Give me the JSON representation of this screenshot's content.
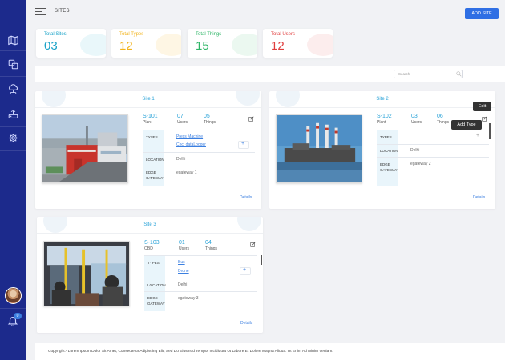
{
  "header": {
    "title": "SITES",
    "add_site_label": "ADD SITE"
  },
  "stats": [
    {
      "label": "Total Sites",
      "value": "03",
      "color": "#1aa3c8"
    },
    {
      "label": "Total Types",
      "value": "12",
      "color": "#f2b31b"
    },
    {
      "label": "Total Things",
      "value": "15",
      "color": "#2db566"
    },
    {
      "label": "Total Users",
      "value": "12",
      "color": "#e03d3d"
    }
  ],
  "search": {
    "placeholder": "Search"
  },
  "sites": [
    {
      "title": "Site 1",
      "metrics": [
        {
          "value": "S-101",
          "label": "Plant"
        },
        {
          "value": "07",
          "label": "Users"
        },
        {
          "value": "05",
          "label": "Things"
        }
      ],
      "labels": {
        "types": "TYPES",
        "location": "LOCATION",
        "gateway": "EDGE GATEWAY"
      },
      "types": [
        "Press Machine",
        "Cnc_dataLogger"
      ],
      "location": "Delhi",
      "gateway": "egateway 1",
      "details": "Details"
    },
    {
      "title": "Site 2",
      "metrics": [
        {
          "value": "S-102",
          "label": "Plant"
        },
        {
          "value": "03",
          "label": "Users"
        },
        {
          "value": "06",
          "label": "Things"
        }
      ],
      "labels": {
        "types": "TYPES",
        "location": "LOCATION",
        "gateway": "EDGE GATEWAY"
      },
      "types": [],
      "location": "Delhi",
      "gateway": "egateway 2",
      "details": "Details"
    },
    {
      "title": "Site 3",
      "metrics": [
        {
          "value": "S-103",
          "label": "OBD"
        },
        {
          "value": "01",
          "label": "Users"
        },
        {
          "value": "04",
          "label": "Things"
        }
      ],
      "labels": {
        "types": "TYPES",
        "location": "LOCATION",
        "gateway": "EDGE GATEWAY"
      },
      "types": [
        "Bus",
        "Drone"
      ],
      "location": "Delhi",
      "gateway": "egateway 3",
      "details": "Details"
    }
  ],
  "tooltips": {
    "edit": "Edit",
    "add_type": "Add Type"
  },
  "notifications": {
    "count": "0"
  },
  "footer": {
    "text": "Copyright:- Lorem Ipsum Dolor Sit Amet, Consectetur Adipiscing Elit, Sed Do Eiusmod Tempor Incididunt Ut Labore Et Dolore Magna Aliqua. Ut Enim Ad Minim Veniam."
  },
  "colors": {
    "sidebar": "#1c2a8c",
    "accent": "#2aa3d8",
    "link": "#3b7fe0",
    "primary_button": "#2f6fe4"
  }
}
